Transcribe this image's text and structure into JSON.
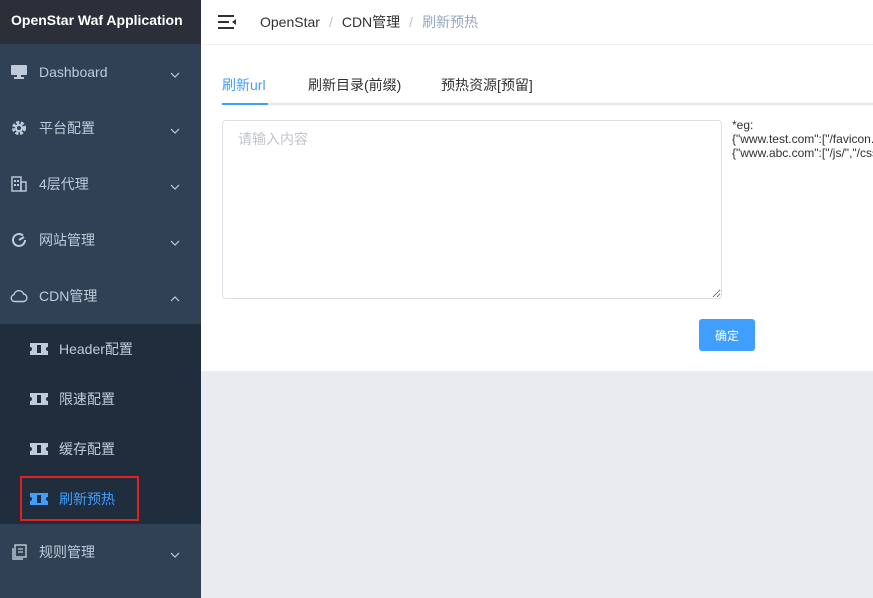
{
  "app": {
    "title": "OpenStar Waf Application"
  },
  "sidebar": {
    "items": [
      {
        "label": "Dashboard",
        "icon": "monitor-icon"
      },
      {
        "label": "平台配置",
        "icon": "gear-icon"
      },
      {
        "label": "4层代理",
        "icon": "building-icon"
      },
      {
        "label": "网站管理",
        "icon": "gauge-icon"
      },
      {
        "label": "CDN管理",
        "icon": "cloud-icon"
      },
      {
        "label": "规则管理",
        "icon": "document-icon"
      }
    ],
    "cdn_children": [
      {
        "label": "Header配置",
        "icon": "ticket-icon"
      },
      {
        "label": "限速配置",
        "icon": "ticket-icon"
      },
      {
        "label": "缓存配置",
        "icon": "ticket-icon"
      },
      {
        "label": "刷新预热",
        "icon": "ticket-icon",
        "active": true
      }
    ]
  },
  "header": {
    "breadcrumb": [
      "OpenStar",
      "CDN管理",
      "刷新预热"
    ]
  },
  "tabs": [
    {
      "label": "刷新url",
      "active": true
    },
    {
      "label": "刷新目录(前缀)"
    },
    {
      "label": "预热资源[预留]"
    }
  ],
  "form": {
    "placeholder": "请输入内容",
    "value": "",
    "hint_line1": "*eg:",
    "hint_line2": "{\"www.test.com\":[\"/favicon.ico\"",
    "hint_line3": "{\"www.abc.com\":[\"/js/\",\"/css/\"",
    "submit_label": "确定"
  },
  "colors": {
    "sidebar_bg": "#304156",
    "submenu_bg": "#1f2d3d",
    "logo_bg": "#2b2f3a",
    "accent": "#409eff",
    "highlight_border": "#e02020"
  }
}
